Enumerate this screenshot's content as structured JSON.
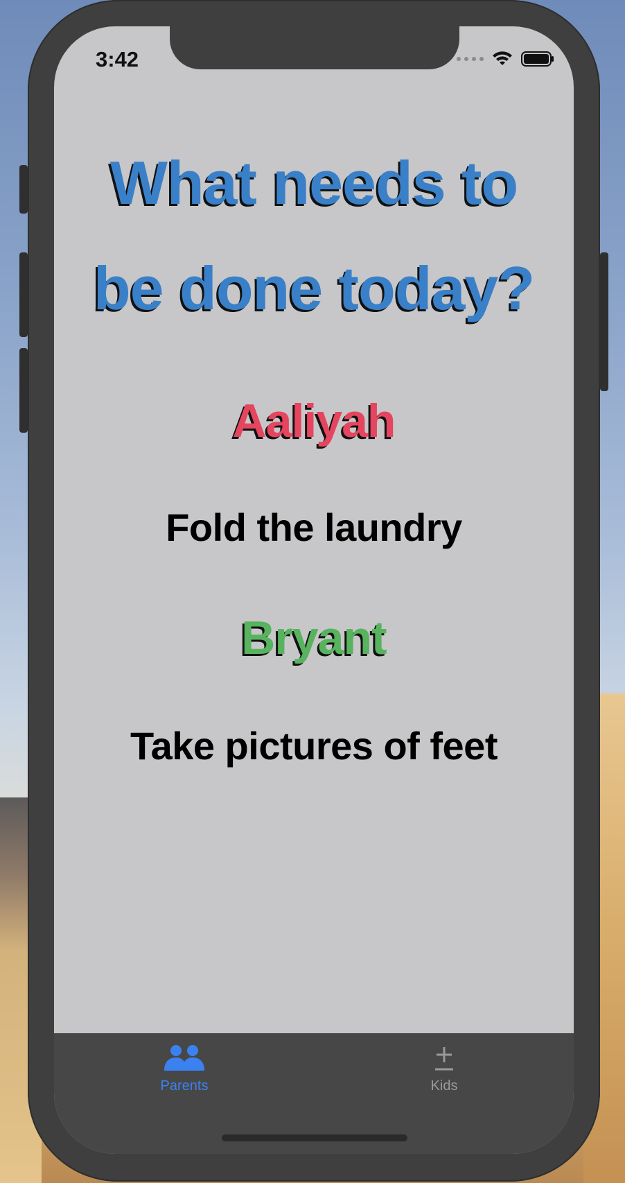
{
  "status_bar": {
    "time": "3:42"
  },
  "main": {
    "title": "What needs to be done today?",
    "assignments": [
      {
        "name": "Aaliyah",
        "chore": "Fold the laundry"
      },
      {
        "name": "Bryant",
        "chore": "Take pictures of feet"
      }
    ]
  },
  "tab_bar": {
    "tabs": [
      {
        "label": "Parents",
        "icon": "people-icon",
        "selected": true
      },
      {
        "label": "Kids",
        "icon": "plus-minus-icon",
        "selected": false
      }
    ]
  },
  "colors": {
    "title": "#3a80c8",
    "aaliyah": "#e5455f",
    "bryant": "#58b35e",
    "tab_selected": "#3b82f0",
    "tab_unselected": "#9a9a9a"
  }
}
